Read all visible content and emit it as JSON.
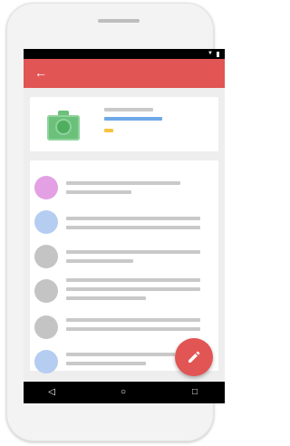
{
  "appbar": {
    "back_icon": "arrow-left-icon"
  },
  "header": {
    "image_icon": "camera-icon",
    "colors": {
      "title_bar": "#c9c9c9",
      "subtitle_bar": "#6ea8e8",
      "badge": "#f6c342"
    }
  },
  "list": {
    "items": [
      {
        "avatar_color": "#e3a0e3"
      },
      {
        "avatar_color": "#b5cdf0"
      },
      {
        "avatar_color": "#c4c4c4"
      },
      {
        "avatar_color": "#c4c4c4"
      },
      {
        "avatar_color": "#c4c4c4"
      },
      {
        "avatar_color": "#b5cdf0"
      }
    ]
  },
  "fab": {
    "icon": "edit-pencil-icon",
    "color": "#e15554"
  },
  "navbar": {
    "icons": [
      "back-triangle-icon",
      "home-circle-icon",
      "recents-square-icon"
    ]
  },
  "colors": {
    "appbar": "#e15554",
    "screen_bg": "#eeeeee"
  }
}
